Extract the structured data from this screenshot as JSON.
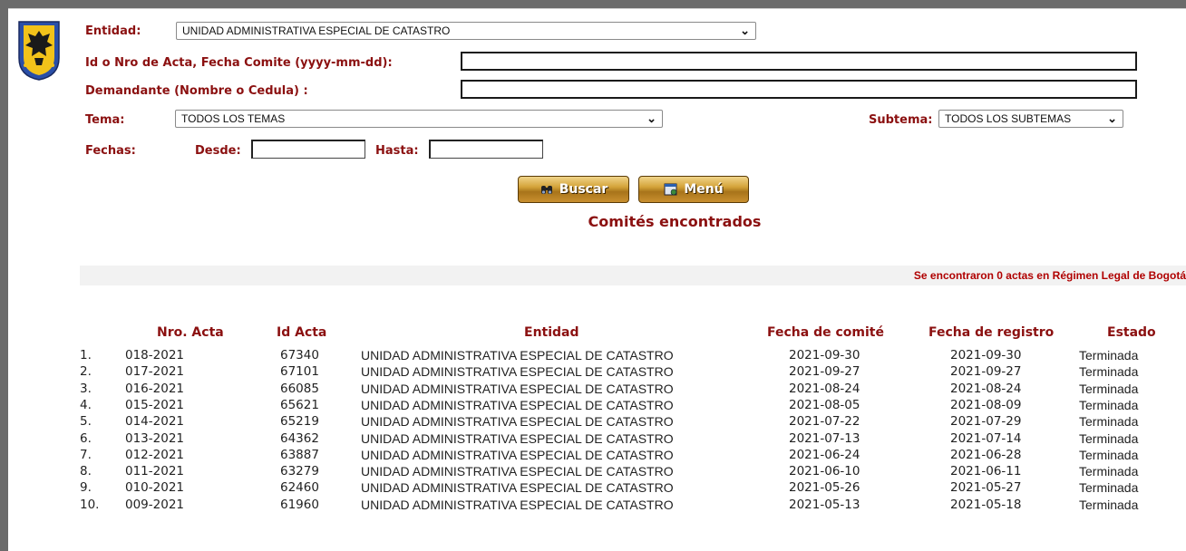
{
  "form": {
    "entidad_label": "Entidad:",
    "entidad_value": "UNIDAD ADMINISTRATIVA ESPECIAL DE CATASTRO",
    "acta_label": "Id o Nro de Acta, Fecha Comite (yyyy-mm-dd):",
    "acta_value": "",
    "demandante_label": "Demandante (Nombre o Cedula) :",
    "demandante_value": "",
    "tema_label": "Tema:",
    "tema_value": "TODOS LOS TEMAS",
    "subtema_label": "Subtema:",
    "subtema_value": "TODOS LOS SUBTEMAS",
    "fechas_label": "Fechas:",
    "desde_label": "Desde:",
    "hasta_label": "Hasta:",
    "desde_value": "",
    "hasta_value": ""
  },
  "buttons": {
    "buscar": "Buscar",
    "menu": "Menú"
  },
  "results": {
    "title": "Comités encontrados",
    "summary": "Se encontraron 0 actas en Régimen Legal de Bogotá"
  },
  "table": {
    "headers": {
      "nro_acta": "Nro. Acta",
      "id_acta": "Id Acta",
      "entidad": "Entidad",
      "fecha_comite": "Fecha de comité",
      "fecha_registro": "Fecha de registro",
      "estado": "Estado"
    },
    "rows": [
      {
        "n": "1.",
        "acta": "018-2021",
        "id": "67340",
        "entidad": "UNIDAD ADMINISTRATIVA ESPECIAL DE CATASTRO",
        "fc": "2021-09-30",
        "fr": "2021-09-30",
        "estado": "Terminada"
      },
      {
        "n": "2.",
        "acta": "017-2021",
        "id": "67101",
        "entidad": "UNIDAD ADMINISTRATIVA ESPECIAL DE CATASTRO",
        "fc": "2021-09-27",
        "fr": "2021-09-27",
        "estado": "Terminada"
      },
      {
        "n": "3.",
        "acta": "016-2021",
        "id": "66085",
        "entidad": "UNIDAD ADMINISTRATIVA ESPECIAL DE CATASTRO",
        "fc": "2021-08-24",
        "fr": "2021-08-24",
        "estado": "Terminada"
      },
      {
        "n": "4.",
        "acta": "015-2021",
        "id": "65621",
        "entidad": "UNIDAD ADMINISTRATIVA ESPECIAL DE CATASTRO",
        "fc": "2021-08-05",
        "fr": "2021-08-09",
        "estado": "Terminada"
      },
      {
        "n": "5.",
        "acta": "014-2021",
        "id": "65219",
        "entidad": "UNIDAD ADMINISTRATIVA ESPECIAL DE CATASTRO",
        "fc": "2021-07-22",
        "fr": "2021-07-29",
        "estado": "Terminada"
      },
      {
        "n": "6.",
        "acta": "013-2021",
        "id": "64362",
        "entidad": "UNIDAD ADMINISTRATIVA ESPECIAL DE CATASTRO",
        "fc": "2021-07-13",
        "fr": "2021-07-14",
        "estado": "Terminada"
      },
      {
        "n": "7.",
        "acta": "012-2021",
        "id": "63887",
        "entidad": "UNIDAD ADMINISTRATIVA ESPECIAL DE CATASTRO",
        "fc": "2021-06-24",
        "fr": "2021-06-28",
        "estado": "Terminada"
      },
      {
        "n": "8.",
        "acta": "011-2021",
        "id": "63279",
        "entidad": "UNIDAD ADMINISTRATIVA ESPECIAL DE CATASTRO",
        "fc": "2021-06-10",
        "fr": "2021-06-11",
        "estado": "Terminada"
      },
      {
        "n": "9.",
        "acta": "010-2021",
        "id": "62460",
        "entidad": "UNIDAD ADMINISTRATIVA ESPECIAL DE CATASTRO",
        "fc": "2021-05-26",
        "fr": "2021-05-27",
        "estado": "Terminada"
      },
      {
        "n": "10.",
        "acta": "009-2021",
        "id": "61960",
        "entidad": "UNIDAD ADMINISTRATIVA ESPECIAL DE CATASTRO",
        "fc": "2021-05-13",
        "fr": "2021-05-18",
        "estado": "Terminada"
      }
    ]
  },
  "icons": {
    "crest": "bogota-coat-of-arms-icon",
    "buscar": "binoculars-icon",
    "menu": "window-icon"
  },
  "colors": {
    "label": "#8b1010",
    "summary": "#b00000",
    "button_gold": "#c99030"
  }
}
